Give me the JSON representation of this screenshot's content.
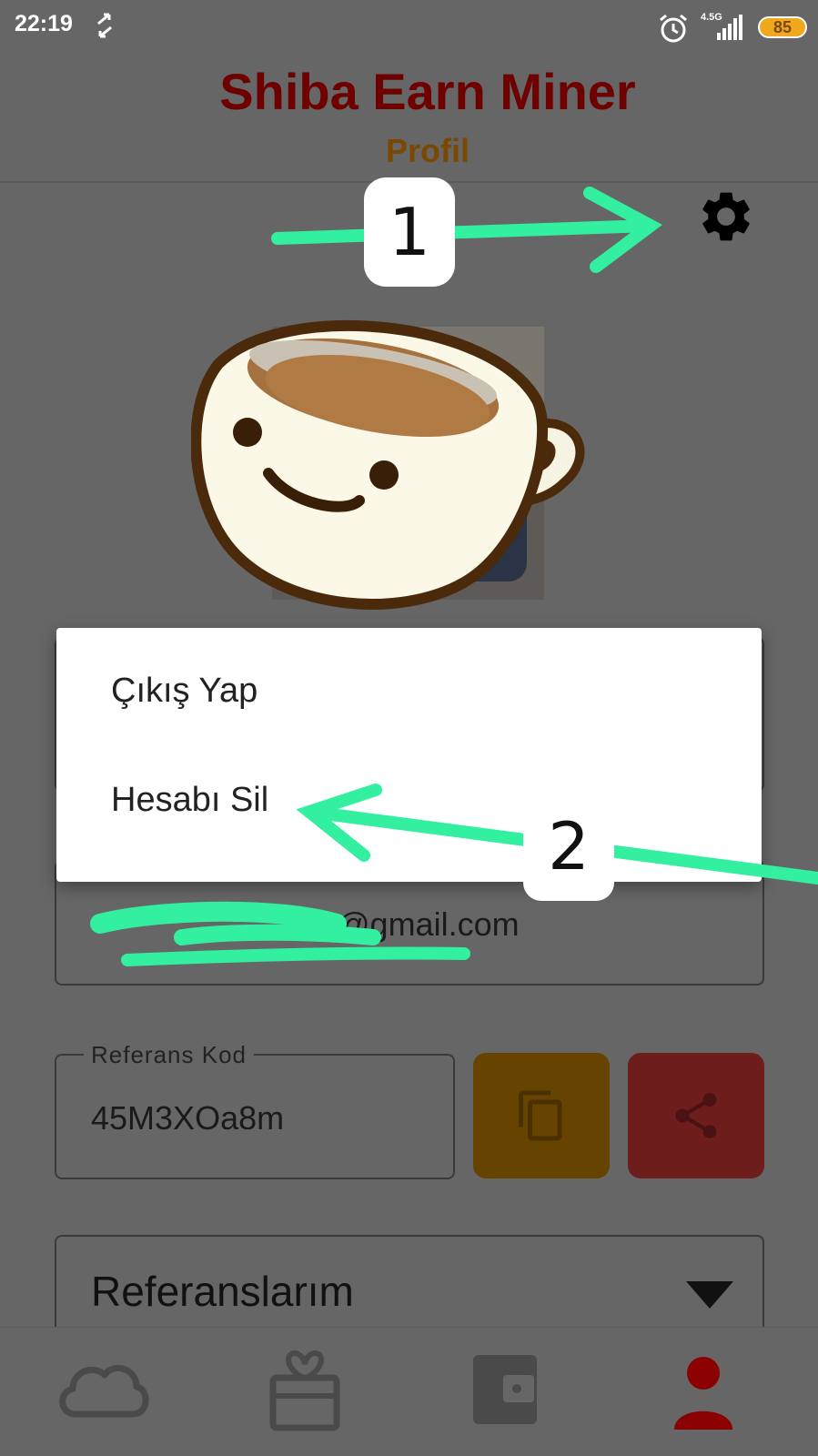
{
  "status_bar": {
    "time": "22:19",
    "network": "4.5G",
    "battery": "85",
    "icons": [
      "sync-icon",
      "alarm-icon",
      "signal-icon",
      "battery-icon"
    ]
  },
  "header": {
    "app_title": "Shiba Earn Miner",
    "page_title": "Profil"
  },
  "settings": {
    "icon": "gear-icon"
  },
  "menu": {
    "items": [
      {
        "label": "Çıkış Yap"
      },
      {
        "label": "Hesabı Sil"
      }
    ]
  },
  "profile": {
    "email_visible": "@gmail.com",
    "referral_label": "Referans Kod",
    "referral_code": "45M3XOa8m",
    "copy_icon": "copy-icon",
    "share_icon": "share-icon",
    "referrals_title": "Referanslarım"
  },
  "bottom_nav": {
    "items": [
      "cloud-icon",
      "gift-icon",
      "wallet-icon",
      "person-icon"
    ],
    "active": "person-icon"
  },
  "annotations": {
    "step_1": "1",
    "step_2": "2"
  },
  "colors": {
    "overlay_bg": "#666666",
    "title": "#6e0000",
    "subtitle": "#7a4800",
    "copy_button": "#664400",
    "share_button": "#6e1d1d",
    "nav_active": "#8b0000",
    "annotation": "#33f0a0"
  }
}
